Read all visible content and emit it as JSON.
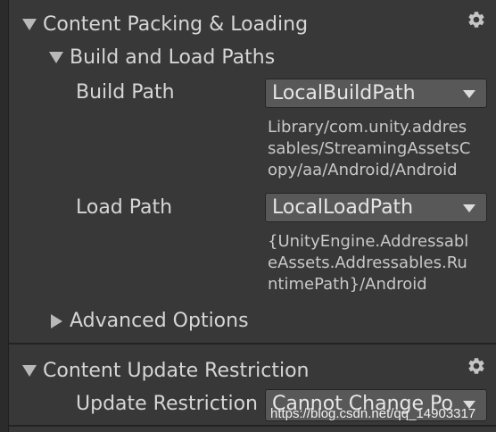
{
  "content_packing": {
    "header": "Content Packing & Loading",
    "gear_icon": "gear-icon",
    "build_and_load_paths": {
      "header": "Build and Load Paths",
      "build_path": {
        "label": "Build Path",
        "value": "LocalBuildPath",
        "resolved_lines": [
          "Library/com.unity.addres",
          "sables/StreamingAssetsC",
          "opy/aa/Android/Android"
        ]
      },
      "load_path": {
        "label": "Load Path",
        "value": "LocalLoadPath",
        "resolved_lines": [
          "{UnityEngine.Addressabl",
          "eAssets.Addressables.Ru",
          "ntimePath}/Android"
        ]
      }
    },
    "advanced_options": {
      "header": "Advanced Options"
    }
  },
  "content_update": {
    "header": "Content Update Restriction",
    "gear_icon": "gear-icon",
    "update_restriction": {
      "label": "Update Restriction",
      "value": "Cannot Change Po"
    }
  },
  "watermark": "https://blog.csdn.net/qq_14903317",
  "colors": {
    "background": "#383838",
    "dropdown": "#585858",
    "text": "#d2d2d2"
  }
}
